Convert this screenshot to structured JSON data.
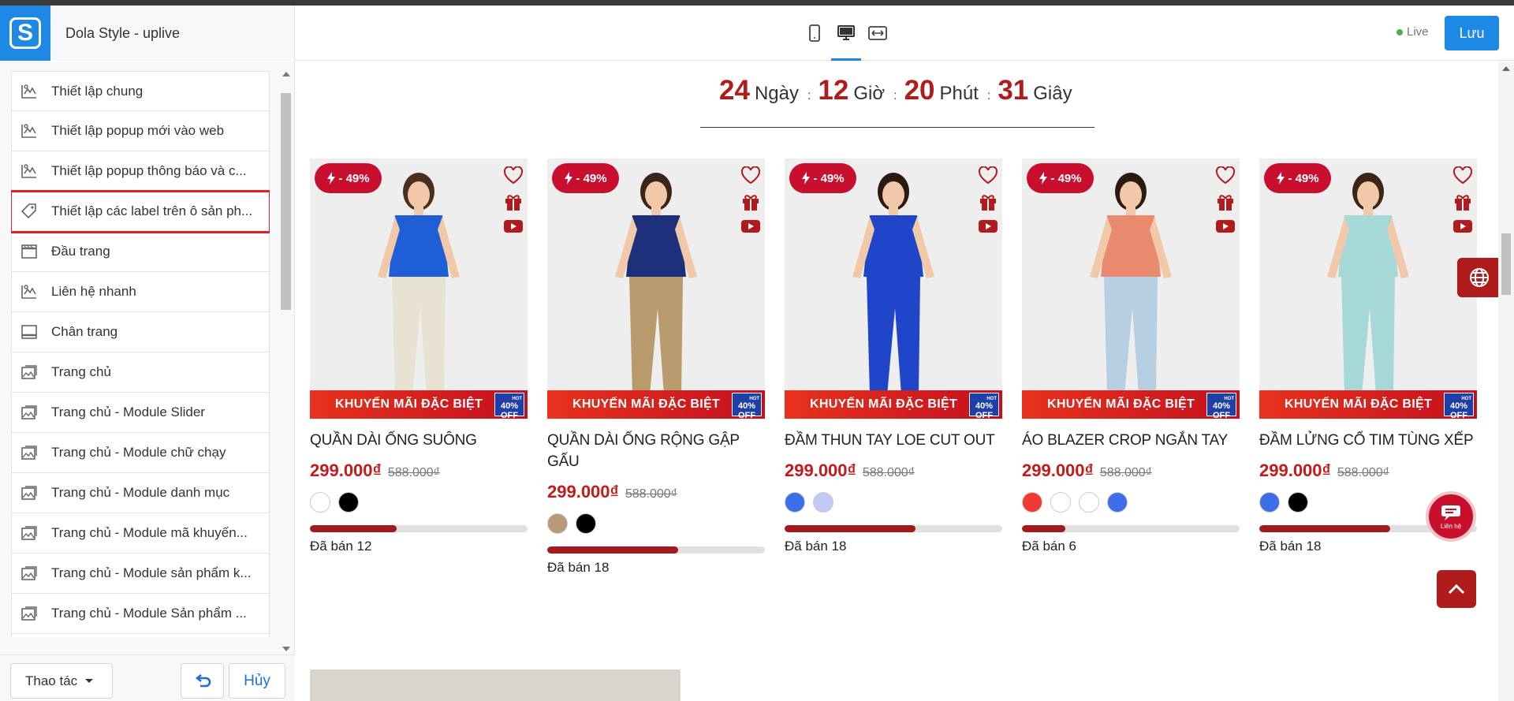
{
  "header": {
    "site_title": "Dola Style - uplive",
    "live_label": "Live",
    "save_label": "Lưu",
    "devices": [
      "mobile-icon",
      "desktop-icon",
      "fullwidth-icon"
    ]
  },
  "sidebar": {
    "items": [
      {
        "label": "Thiết lập chung",
        "icon": "settings-brush-icon"
      },
      {
        "label": "Thiết lập popup mới vào web",
        "icon": "settings-brush-icon"
      },
      {
        "label": "Thiết lập popup thông báo và c...",
        "icon": "settings-brush-icon"
      },
      {
        "label": "Thiết lập các label trên ô sản ph...",
        "icon": "tag-icon"
      },
      {
        "label": "Đầu trang",
        "icon": "header-layout-icon"
      },
      {
        "label": "Liên hệ nhanh",
        "icon": "settings-brush-icon"
      },
      {
        "label": "Chân trang",
        "icon": "footer-layout-icon"
      },
      {
        "label": "Trang chủ",
        "icon": "image-icon"
      },
      {
        "label": "Trang chủ - Module Slider",
        "icon": "image-icon"
      },
      {
        "label": "Trang chủ - Module chữ chạy",
        "icon": "image-icon"
      },
      {
        "label": "Trang chủ - Module danh mục",
        "icon": "image-icon"
      },
      {
        "label": "Trang chủ - Module mã khuyến...",
        "icon": "image-icon"
      },
      {
        "label": "Trang chủ - Module sản phẩm k...",
        "icon": "image-icon"
      },
      {
        "label": "Trang chủ - Module Sản phẩm ...",
        "icon": "image-icon"
      },
      {
        "label": "Trang chủ - Module Sản phẩm ...",
        "icon": "image-icon"
      }
    ],
    "actions_label": "Thao tác",
    "cancel_label": "Hủy"
  },
  "countdown": {
    "days": "24",
    "days_unit": "Ngày",
    "hours": "12",
    "hours_unit": "Giờ",
    "minutes": "20",
    "minutes_unit": "Phút",
    "seconds": "31",
    "seconds_unit": "Giây",
    "separator": ":"
  },
  "products": [
    {
      "discount": "- 49%",
      "banner": "KHUYẾN MÃI ĐẶC BIỆT",
      "badge_hot": "HOT",
      "badge": "40%",
      "badge2": "OFF",
      "name": "QUẦN DÀI ỐNG SUÔNG",
      "price": "299.000₫",
      "old_price": "588.000₫",
      "swatches": [
        "#ffffff",
        "#000000"
      ],
      "sold_label": "Đã bán 12",
      "progress": 0.4
    },
    {
      "discount": "- 49%",
      "banner": "KHUYẾN MÃI ĐẶC BIỆT",
      "badge_hot": "HOT",
      "badge": "40%",
      "badge2": "OFF",
      "name": "QUẦN DÀI ỐNG RỘNG GẬP GẤU",
      "price": "299.000₫",
      "old_price": "588.000₫",
      "swatches": [
        "#b89a78",
        "#000000"
      ],
      "sold_label": "Đã bán 18",
      "progress": 0.6
    },
    {
      "discount": "- 49%",
      "banner": "KHUYẾN MÃI ĐẶC BIỆT",
      "badge_hot": "HOT",
      "badge": "40%",
      "badge2": "OFF",
      "name": "ĐẦM THUN TAY LOE CUT OUT",
      "price": "299.000₫",
      "old_price": "588.000₫",
      "swatches": [
        "#3a6fe8",
        "#c4c8f5"
      ],
      "sold_label": "Đã bán 18",
      "progress": 0.6
    },
    {
      "discount": "- 49%",
      "banner": "KHUYẾN MÃI ĐẶC BIỆT",
      "badge_hot": "HOT",
      "badge": "40%",
      "badge2": "OFF",
      "name": "ÁO BLAZER CROP NGẮN TAY",
      "price": "299.000₫",
      "old_price": "588.000₫",
      "swatches": [
        "#ef3a32",
        "#ffffff",
        "#ffffff",
        "#3a6fe8"
      ],
      "sold_label": "Đã bán 6",
      "progress": 0.2
    },
    {
      "discount": "- 49%",
      "banner": "KHUYẾN MÃI ĐẶC BIỆT",
      "badge_hot": "HOT",
      "badge": "40%",
      "badge2": "OFF",
      "name": "ĐẦM LỬNG CỔ TIM TÙNG XẾP",
      "price": "299.000₫",
      "old_price": "588.000₫",
      "swatches": [
        "#3a6fe8",
        "#000000"
      ],
      "sold_label": "Đã bán 18",
      "progress": 0.6
    }
  ],
  "floating": {
    "chat_label": "Liên hệ"
  },
  "colors": {
    "accent": "#1e88e5",
    "brand_red": "#b01c1c",
    "highlight": "#e31f26"
  }
}
